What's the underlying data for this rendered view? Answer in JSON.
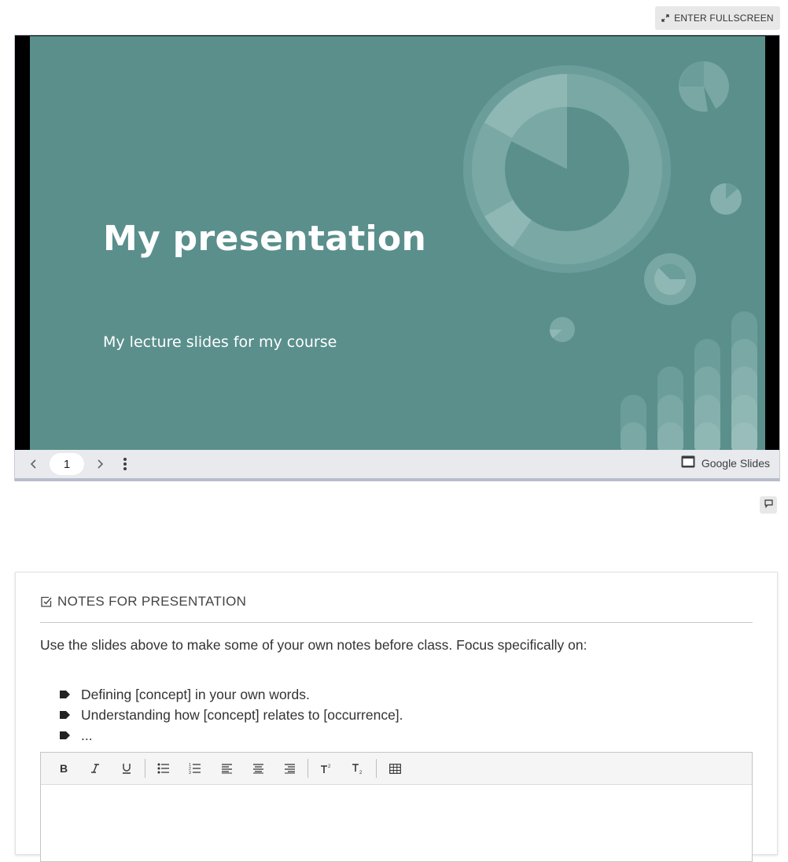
{
  "fullscreen_button": {
    "label": "ENTER FULLSCREEN",
    "icon": "expand-icon"
  },
  "slide": {
    "title": "My presentation",
    "subtitle": "My lecture slides for my course",
    "background_color": "#5a8f8c"
  },
  "slides_controls": {
    "page_number": "1",
    "prev_icon": "chevron-left-icon",
    "next_icon": "chevron-right-icon",
    "more_icon": "more-vertical-icon",
    "brand_label": "Google Slides",
    "brand_icon": "slides-icon"
  },
  "comment_icon": "comment-icon",
  "notes": {
    "heading": "NOTES FOR PRESENTATION",
    "heading_icon": "checkbox-edit-icon",
    "intro": "Use the slides above to make some of your own notes before class. Focus specifically on:",
    "bullets": [
      "Defining [concept] in your own words.",
      "Understanding how [concept] relates to [occurrence].",
      "..."
    ]
  },
  "editor_toolbar": {
    "buttons": [
      "bold",
      "italic",
      "underline",
      "bulleted-list",
      "numbered-list",
      "align-left",
      "align-center",
      "align-right",
      "superscript",
      "subscript",
      "table"
    ]
  }
}
